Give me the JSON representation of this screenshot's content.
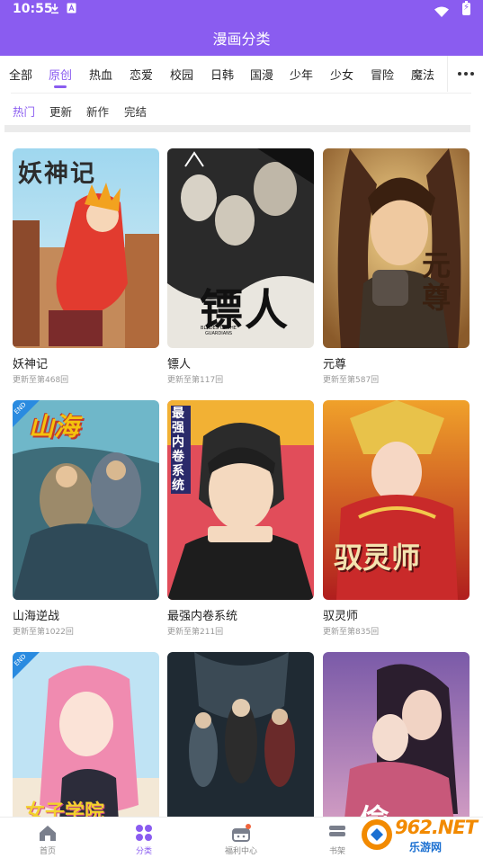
{
  "status_bar": {
    "time": "10:55",
    "icons": [
      "download-icon",
      "app-a-icon",
      "wifi-icon",
      "battery-charging-icon"
    ]
  },
  "header": {
    "title": "漫画分类"
  },
  "category_tabs": [
    {
      "label": "全部",
      "active": false
    },
    {
      "label": "原创",
      "active": true
    },
    {
      "label": "热血",
      "active": false
    },
    {
      "label": "恋爱",
      "active": false
    },
    {
      "label": "校园",
      "active": false
    },
    {
      "label": "日韩",
      "active": false
    },
    {
      "label": "国漫",
      "active": false
    },
    {
      "label": "少年",
      "active": false
    },
    {
      "label": "少女",
      "active": false
    },
    {
      "label": "冒险",
      "active": false
    },
    {
      "label": "魔法",
      "active": false
    }
  ],
  "more_button": {
    "icon": "more-dots-icon"
  },
  "sort_tabs": [
    {
      "label": "热门",
      "active": true
    },
    {
      "label": "更新",
      "active": false
    },
    {
      "label": "新作",
      "active": false
    },
    {
      "label": "完结",
      "active": false
    }
  ],
  "comics": [
    {
      "title": "妖神记",
      "update": "更新至第468回",
      "cover_text": "妖神记",
      "end": false
    },
    {
      "title": "镖人",
      "update": "更新至第117回",
      "cover_text": "镖人",
      "cover_subtext": "BLADES OF THE GUARDIANS",
      "end": false
    },
    {
      "title": "元尊",
      "update": "更新至第587回",
      "cover_text": "元尊",
      "end": false
    },
    {
      "title": "山海逆战",
      "update": "更新至第1022回",
      "cover_text": "山海",
      "end": true,
      "badge": "END"
    },
    {
      "title": "最强内卷系统",
      "update": "更新至第211回",
      "cover_text": "最强内卷系统",
      "end": false
    },
    {
      "title": "驭灵师",
      "update": "更新至第835回",
      "cover_text": "驭灵师",
      "end": false
    },
    {
      "title": "",
      "update": "",
      "cover_text": "女子学院",
      "end": true,
      "badge": "END"
    },
    {
      "title": "",
      "update": "",
      "cover_text": "",
      "end": false
    },
    {
      "title": "",
      "update": "",
      "cover_text": "偷",
      "end": false
    }
  ],
  "bottom_nav": [
    {
      "label": "首页",
      "icon": "home-icon",
      "active": false
    },
    {
      "label": "分类",
      "icon": "category-icon",
      "active": true
    },
    {
      "label": "福利中心",
      "icon": "gift-icon",
      "active": false
    },
    {
      "label": "书架",
      "icon": "bookshelf-icon",
      "active": false
    }
  ],
  "watermark": {
    "number": "962.NET",
    "site": "乐游网"
  },
  "colors": {
    "accent": "#8a5cf0",
    "watermark_orange": "#f28a00",
    "watermark_blue": "#1a6fd1"
  }
}
